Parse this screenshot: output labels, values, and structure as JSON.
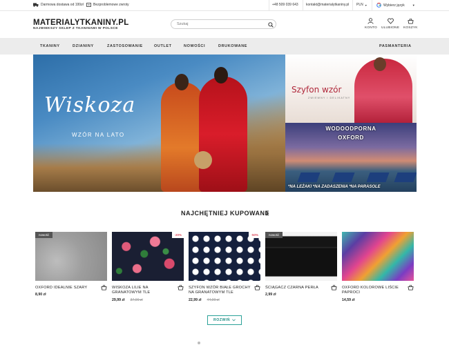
{
  "topbar": {
    "shipping": "Darmowa dostawa od 199zł",
    "returns": "Bezproblemowe zwroty",
    "phone": "+48 509 039 643",
    "email": "kontakt@materialytkaniny.pl",
    "currency": "PLN",
    "language": "Wybierz język"
  },
  "header": {
    "logo": "MATERIALYTKANINY.PL",
    "tagline": "NAJWIEKSZY SKLEP Z TKANINAMI W POLSCE",
    "search_placeholder": "Szukaj",
    "account": "KONTO",
    "favorites": "ULUBIONE",
    "cart": "KOSZYK"
  },
  "nav": {
    "items": [
      "TKANINY",
      "DZIANINY",
      "ZASTOSOWANIE",
      "OUTLET",
      "NOWOŚCI",
      "DRUKOWANE"
    ],
    "right": "PASMANTERIA"
  },
  "hero": {
    "script": "Wiskoza",
    "sub": "WZÓR NA LATO"
  },
  "banner1": {
    "title": "Szyfon wzór",
    "sub": "ZWIEWNY I DELIKATNY"
  },
  "banner2": {
    "title_line1": "WODOODPORNA",
    "title_line2": "OXFORD",
    "tags": "*NA LEŻAKI  *NA ZADASZENIA  *NA PARASOLE"
  },
  "section": {
    "title": "NAJCHĘTNIEJ KUPOWANE"
  },
  "products": [
    {
      "name": "OXFORD IDEALNIE SZARY",
      "price": "8,90 zł",
      "old_price": "",
      "badge": "nowość",
      "sale": ""
    },
    {
      "name": "WISKOZA LILIE NA GRANATOWYM TLE",
      "price": "29,99 zł",
      "old_price": "37,00 zł",
      "badge": "",
      "sale": "-20%"
    },
    {
      "name": "SZYFON WZÓR BIAŁE GROCHY NA GRANATOWYM TLE",
      "price": "22,99 zł",
      "old_price": "44,00 zł",
      "badge": "",
      "sale": "-50%"
    },
    {
      "name": "ŚCIĄGACZ CZARNA PERŁA",
      "price": "2,99 zł",
      "old_price": "",
      "badge": "nowość",
      "sale": ""
    },
    {
      "name": "OXFORD KOLOROWE LIŚCIE PAPROCI",
      "price": "14,59 zł",
      "old_price": "",
      "badge": "",
      "sale": ""
    }
  ],
  "more_button": "ROZWIŃ",
  "colors": {
    "accent": "#2aa198",
    "sale": "#d0021b",
    "nav_bg": "#ececec"
  }
}
